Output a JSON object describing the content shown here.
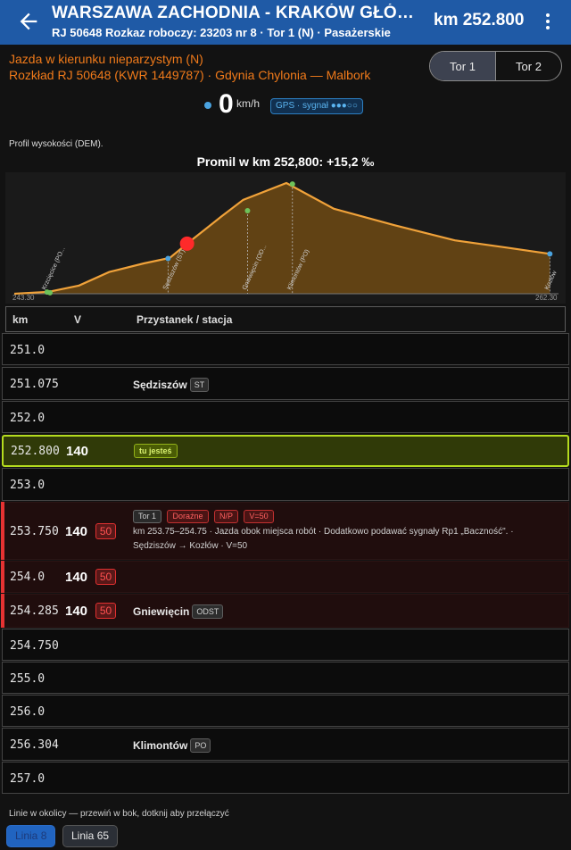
{
  "header": {
    "title": "WARSZAWA ZACHODNIA - KRAKÓW GŁÓWNY · PRZEZ KIELCE",
    "subtitle": "RJ 50648 Rozkaz roboczy: 23203 nr 8 · Tor 1 (N) · Pasażerskie",
    "km": "km 252.800"
  },
  "route": {
    "line1": "Jazda w kierunku nieparzystym (N)",
    "line2": "Rozkład RJ 50648 (KWR 1449787) · Gdynia Chylonia — Malbork"
  },
  "track_toggle": {
    "options": [
      "Tor 1",
      "Tor 2"
    ],
    "selected": "Tor 1"
  },
  "speed": {
    "value": "0",
    "unit": "km/h",
    "gps_label": "GPS · sygnał ●●●○○"
  },
  "profile": {
    "dem_label": "Profil wysokości (DEM).",
    "promil": "Promil w km 252,800: +15,2 ‰",
    "min_label": "243.30",
    "max_label": "262.30",
    "current_km": 252.8,
    "km_range": [
      250.8,
      257.1
    ],
    "elevation": [
      {
        "km": 250.8,
        "elev": 0.0
      },
      {
        "km": 251.2,
        "elev": 0.6
      },
      {
        "km": 251.55,
        "elev": 2.5
      },
      {
        "km": 251.9,
        "elev": 6.6
      },
      {
        "km": 252.3,
        "elev": 9.2
      },
      {
        "km": 252.6,
        "elev": 10.9
      },
      {
        "km": 252.8,
        "elev": 15.2
      },
      {
        "km": 253.2,
        "elev": 23.5
      },
      {
        "km": 253.45,
        "elev": 28.5
      },
      {
        "km": 253.95,
        "elev": 33.6
      },
      {
        "km": 254.5,
        "elev": 25.8
      },
      {
        "km": 255.2,
        "elev": 20.8
      },
      {
        "km": 255.9,
        "elev": 16.2
      },
      {
        "km": 256.5,
        "elev": 14.0
      },
      {
        "km": 257.0,
        "elev": 12.1
      }
    ],
    "markers": [
      {
        "label": "Krzcięcice (PO...",
        "km": 251.18,
        "elev": 0.5,
        "color": "#6ec25a"
      },
      {
        "label": "Sędziszów (ST)",
        "km": 252.58,
        "elev": 10.7,
        "color": "#4aa3e0"
      },
      {
        "label": "Gniewięcin (OD...",
        "km": 253.5,
        "elev": 25.2,
        "color": "#6ec25a"
      },
      {
        "label": "Klimontów (PO)",
        "km": 254.02,
        "elev": 33.3,
        "color": "#6ec25a"
      },
      {
        "label": "Kozłów",
        "km": 257.0,
        "elev": 12.1,
        "color": "#4aa3e0"
      }
    ],
    "colors": {
      "line": "#f0a23a",
      "fill": "#6e4a14",
      "current": "#ff2a2a"
    }
  },
  "table": {
    "headers": {
      "km": "km",
      "v": "V",
      "stop": "Przystanek / stacja"
    },
    "rows": [
      {
        "km": "251.0"
      },
      {
        "km": "251.075",
        "stop": "Sędziszów",
        "stop_badge": "ST"
      },
      {
        "km": "252.0"
      },
      {
        "km": "252.800",
        "v": "140",
        "here_label": "tu jesteś"
      },
      {
        "km": "253.0"
      },
      {
        "km": "253.750",
        "v": "140",
        "limit": "50",
        "tags": [
          "Tor 1",
          "Doraźne",
          "N/P",
          "V=50"
        ],
        "note1": "km 253.75–254.75 · Jazda obok miejsca robót · Dodatkowo podawać sygnały Rp1 „Baczność\". ·",
        "note2": "Sędziszów → Kozłów · V=50"
      },
      {
        "km": "254.0",
        "v": "140",
        "limit": "50"
      },
      {
        "km": "254.285",
        "v": "140",
        "limit": "50",
        "stop": "Gniewięcin",
        "stop_badge": "ODST"
      },
      {
        "km": "254.750"
      },
      {
        "km": "255.0"
      },
      {
        "km": "256.0"
      },
      {
        "km": "256.304",
        "stop": "Klimontów",
        "stop_badge": "PO"
      },
      {
        "km": "257.0"
      }
    ]
  },
  "footer": {
    "text": "Linie w okolicy — przewiń w bok, dotknij aby przełączyć",
    "chips": [
      "Linia 8",
      "Linia 65"
    ],
    "active_chip": "Linia 8"
  }
}
